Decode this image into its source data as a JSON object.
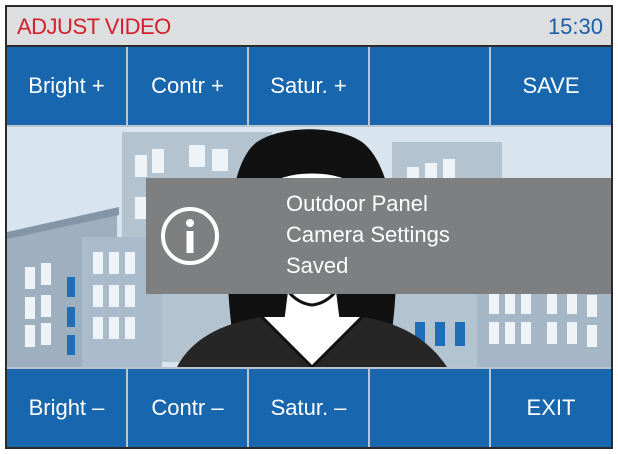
{
  "header": {
    "title": "ADJUST VIDEO",
    "time": "15:30"
  },
  "top_buttons": [
    {
      "label": "Bright +"
    },
    {
      "label": "Contr +"
    },
    {
      "label": "Satur. +"
    },
    {
      "label": ""
    },
    {
      "label": "SAVE"
    }
  ],
  "bottom_buttons": [
    {
      "label": "Bright –"
    },
    {
      "label": "Contr –"
    },
    {
      "label": "Satur. –"
    },
    {
      "label": ""
    },
    {
      "label": "EXIT"
    }
  ],
  "notification": {
    "icon": "info-icon",
    "line1": "Outdoor Panel",
    "line2": "Camera Settings",
    "line3": "Saved"
  },
  "colors": {
    "button_bg": "#1866ad",
    "title_red": "#d4202a",
    "clock_blue": "#1a5ea8",
    "toast_bg": "#7d7f81"
  }
}
